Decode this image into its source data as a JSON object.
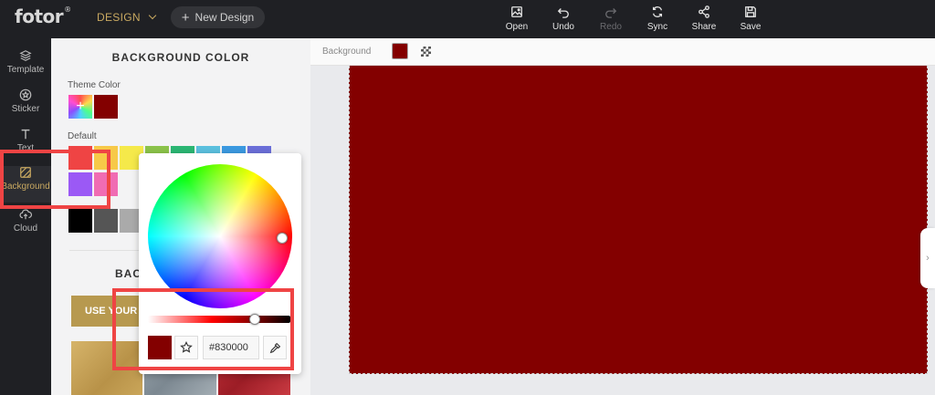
{
  "app": {
    "logo": "fotor",
    "logo_mark": "®",
    "mode": "DESIGN",
    "new_design": "New Design"
  },
  "toolbar": [
    {
      "label": "Open",
      "icon": "open-image-icon",
      "enabled": true
    },
    {
      "label": "Undo",
      "icon": "undo-icon",
      "enabled": true
    },
    {
      "label": "Redo",
      "icon": "redo-icon",
      "enabled": false
    },
    {
      "label": "Sync",
      "icon": "sync-icon",
      "enabled": true
    },
    {
      "label": "Share",
      "icon": "share-icon",
      "enabled": true
    },
    {
      "label": "Save",
      "icon": "save-icon",
      "enabled": true
    }
  ],
  "rail": [
    {
      "label": "Template",
      "icon": "layers-icon",
      "active": false
    },
    {
      "label": "Sticker",
      "icon": "star-circle-icon",
      "active": false
    },
    {
      "label": "Text",
      "icon": "text-t-icon",
      "active": false
    },
    {
      "label": "Background",
      "icon": "background-hatch-icon",
      "active": true
    },
    {
      "label": "Cloud",
      "icon": "cloud-upload-icon",
      "active": false
    }
  ],
  "panel": {
    "title": "BACKGROUND COLOR",
    "theme_label": "Theme Color",
    "theme_add": "+",
    "theme_color": "#830000",
    "default_label": "Default",
    "default_row1": [
      "#ef4444",
      "#f7c948",
      "#f5e94a",
      "#8bc34a",
      "#2bb673",
      "#5bc0de",
      "#3b99e0",
      "#6b6fd8"
    ],
    "default_row2": [
      "#9b59f5",
      "#f06cb3"
    ],
    "default_row3": [
      "#000000",
      "#555555",
      "#aaaaaa"
    ],
    "backgrounds_heading": "BACKGROUNDS",
    "use_button": "USE YOUR OWN",
    "thumbs": [
      "#c9a961",
      "#8f9aa3",
      "#b0252e"
    ]
  },
  "canvas": {
    "bar_label": "Background",
    "color": "#830000"
  },
  "picker": {
    "hex": "#830000"
  },
  "colors": {
    "accent": "#c9a961",
    "annotation": "#ef4444"
  }
}
